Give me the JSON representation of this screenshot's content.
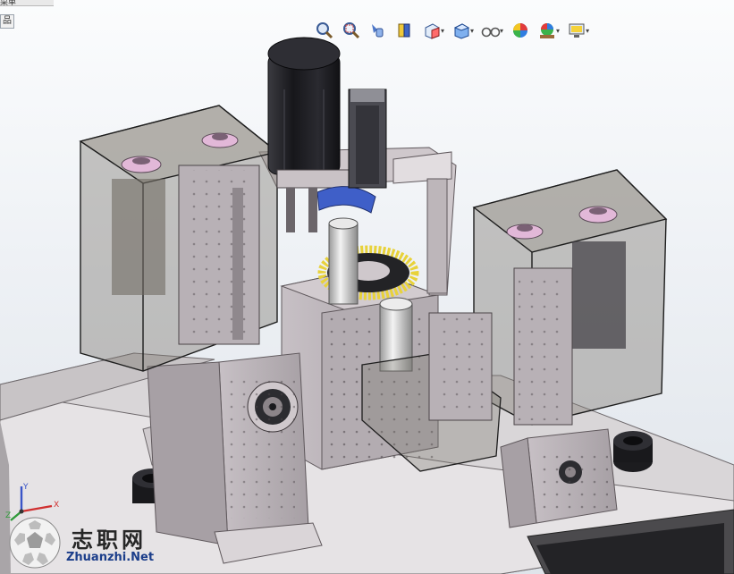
{
  "window": {
    "menu_fragment": "菜单"
  },
  "feature_tree_tab": {
    "label": "品"
  },
  "toolbar": {
    "tools": [
      {
        "name": "zoom-to-fit",
        "icon": "magnifier-icon",
        "has_dropdown": false
      },
      {
        "name": "zoom-to-area",
        "icon": "zoom-area-icon",
        "has_dropdown": false
      },
      {
        "name": "previous-view",
        "icon": "previous-view-icon",
        "has_dropdown": false
      },
      {
        "name": "section-view",
        "icon": "section-view-icon",
        "has_dropdown": false
      },
      {
        "name": "view-orientation",
        "icon": "view-orientation-icon",
        "has_dropdown": true
      },
      {
        "name": "display-style",
        "icon": "display-style-icon",
        "has_dropdown": true
      },
      {
        "name": "hide-show-items",
        "icon": "glasses-icon",
        "has_dropdown": true
      },
      {
        "name": "edit-appearance",
        "icon": "appearance-icon",
        "has_dropdown": false
      },
      {
        "name": "apply-scene",
        "icon": "scene-icon",
        "has_dropdown": true
      },
      {
        "name": "view-settings",
        "icon": "monitor-icon",
        "has_dropdown": true
      }
    ]
  },
  "triad": {
    "x_label": "X",
    "y_label": "Y",
    "z_label": "Z"
  },
  "watermark": {
    "title": "志职网",
    "url": "Zhuanzhi.Net"
  },
  "colors": {
    "enclosure_fill": "#7f7a72",
    "metal": "#b9b2b7",
    "metal_dark": "#8f888d",
    "motor": "#1f1f23",
    "gear_yellow": "#e8d23a",
    "pink_pulley": "#e2b8d8",
    "blue_part": "#3f5fc8",
    "watermark_url": "#1b3d8a"
  }
}
